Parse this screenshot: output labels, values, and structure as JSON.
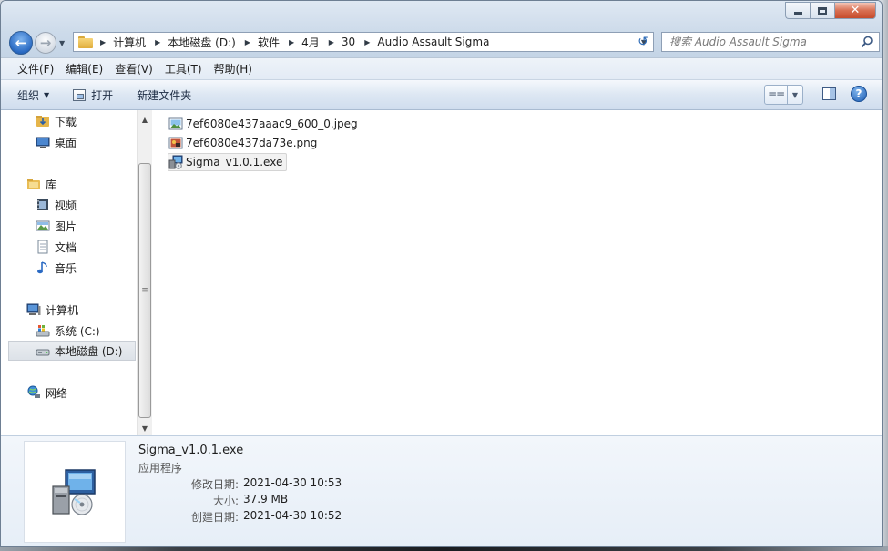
{
  "window": {
    "controls": {
      "minimize": "–",
      "maximize": "□",
      "close": "✕"
    }
  },
  "address": {
    "crumbs": [
      "计算机",
      "本地磁盘 (D:)",
      "软件",
      "4月",
      "30",
      "Audio Assault Sigma"
    ]
  },
  "search": {
    "placeholder": "搜索 Audio Assault Sigma"
  },
  "menu": [
    "文件(F)",
    "编辑(E)",
    "查看(V)",
    "工具(T)",
    "帮助(H)"
  ],
  "toolbar": {
    "organize": "组织",
    "open": "打开",
    "new_folder": "新建文件夹",
    "help": "?"
  },
  "nav": {
    "favorites": [
      {
        "label": "下载",
        "icon": "download-folder-icon"
      },
      {
        "label": "桌面",
        "icon": "desktop-icon"
      }
    ],
    "libraries_label": "库",
    "libraries": [
      {
        "label": "视频",
        "icon": "video-icon"
      },
      {
        "label": "图片",
        "icon": "pictures-icon"
      },
      {
        "label": "文档",
        "icon": "documents-icon"
      },
      {
        "label": "音乐",
        "icon": "music-icon"
      }
    ],
    "computer_label": "计算机",
    "drives": [
      {
        "label": "系统 (C:)",
        "icon": "system-drive-icon"
      },
      {
        "label": "本地磁盘 (D:)",
        "icon": "local-drive-icon",
        "selected": true
      }
    ],
    "network_label": "网络"
  },
  "files": [
    {
      "name": "7ef6080e437aaac9_600_0.jpeg",
      "icon": "jpeg-image-icon"
    },
    {
      "name": "7ef6080e437da73e.png",
      "icon": "png-image-icon"
    },
    {
      "name": "Sigma_v1.0.1.exe",
      "icon": "installer-exe-icon",
      "selected": true
    }
  ],
  "details": {
    "name": "Sigma_v1.0.1.exe",
    "type": "应用程序",
    "modified_label": "修改日期:",
    "modified": "2021-04-30 10:53",
    "size_label": "大小:",
    "size": "37.9 MB",
    "created_label": "创建日期:",
    "created": "2021-04-30 10:52"
  },
  "colors": {
    "selection": "#f2f2f2",
    "toolbar": "#dde7f3",
    "close_button": "#c64c2c"
  }
}
